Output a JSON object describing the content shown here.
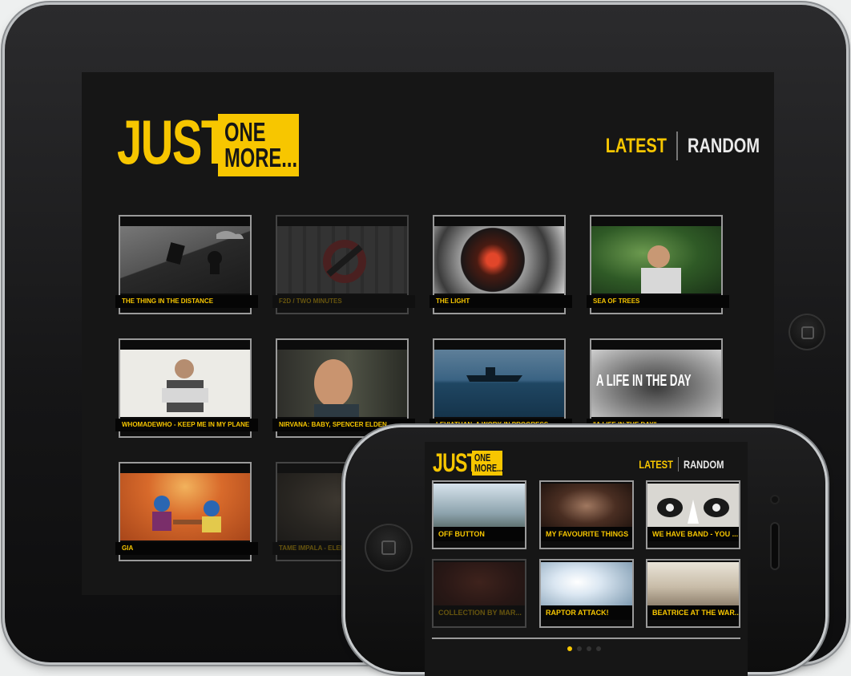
{
  "brand": {
    "just": "JUST",
    "one": "ONE",
    "more": "MORE..."
  },
  "nav": {
    "latest": "LATEST",
    "random": "RANDOM"
  },
  "colors": {
    "accent": "#f7c600",
    "screen_bg": "#161616",
    "caption_bg": "#050505"
  },
  "tablet_videos": [
    {
      "title": "THE THING IN THE DISTANCE",
      "dimmed": false
    },
    {
      "title": "F2D / TWO MINUTES",
      "dimmed": true
    },
    {
      "title": "THE LIGHT",
      "dimmed": false
    },
    {
      "title": "SEA OF TREES",
      "dimmed": false
    },
    {
      "title": "WHOMADEWHO - KEEP ME IN MY PLANE",
      "dimmed": false
    },
    {
      "title": "NIRVANA: BABY, SPENCER ELDEN",
      "dimmed": false
    },
    {
      "title": "LEVIATHAN, A WORK IN PROGRESS",
      "dimmed": false
    },
    {
      "title": "\"A LIFE IN THE DAY\"",
      "dimmed": false,
      "overlay": "A LIFE IN THE DAY"
    },
    {
      "title": "GIA",
      "dimmed": false
    },
    {
      "title": "TAME IMPALA - ELEPHANT",
      "dimmed": true
    }
  ],
  "phone_videos": [
    {
      "title": "OFF BUTTON",
      "dimmed": false
    },
    {
      "title": "MY FAVOURITE THINGS",
      "dimmed": false
    },
    {
      "title": "WE HAVE BAND - YOU ...",
      "dimmed": false
    },
    {
      "title": "COLLECTION BY MAR...",
      "dimmed": true
    },
    {
      "title": "RAPTOR ATTACK!",
      "dimmed": false
    },
    {
      "title": "BEATRICE AT THE WAR...",
      "dimmed": false
    }
  ],
  "pagination": {
    "pages": 4,
    "current": 1
  }
}
